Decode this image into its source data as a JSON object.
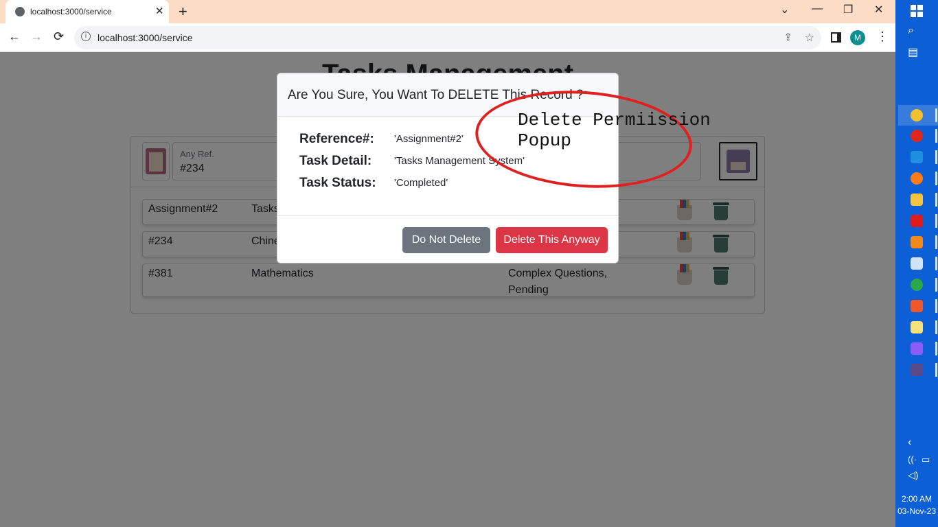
{
  "browser": {
    "tab_title": "localhost:3000/service",
    "new_tab": "+",
    "close_tab": "✕",
    "url": "localhost:3000/service",
    "profile_initial": "M",
    "window_controls": [
      "⌄",
      "—",
      "❐",
      "✕"
    ],
    "nav": {
      "back": "←",
      "forward": "→",
      "reload": "⟳"
    }
  },
  "page": {
    "title": "Tasks Management",
    "search": {
      "label": "Any Ref.",
      "value": "#234"
    },
    "rows": [
      {
        "ref": "Assignment#2",
        "detail": "Tasks Management System",
        "status": ""
      },
      {
        "ref": "#234",
        "detail": "Chinese",
        "status": ""
      },
      {
        "ref": "#381",
        "detail": "Mathematics",
        "status": "Complex Questions, Pending"
      }
    ]
  },
  "modal": {
    "title": "Are You Sure, You Want To DELETE This Record ?",
    "fields": [
      {
        "label": "Reference#:",
        "value": "'Assignment#2'"
      },
      {
        "label": "Task Detail:",
        "value": "'Tasks Management System'"
      },
      {
        "label": "Task Status:",
        "value": "'Completed'"
      }
    ],
    "cancel_label": "Do Not Delete",
    "confirm_label": "Delete This Anyway"
  },
  "annotation": {
    "line1": "Delete Permiission",
    "line2": "Popup",
    "color": "#e0201e"
  },
  "taskbar": {
    "time": "2:00 AM",
    "date": "03-Nov-23",
    "accent": "#0d5fd6"
  }
}
